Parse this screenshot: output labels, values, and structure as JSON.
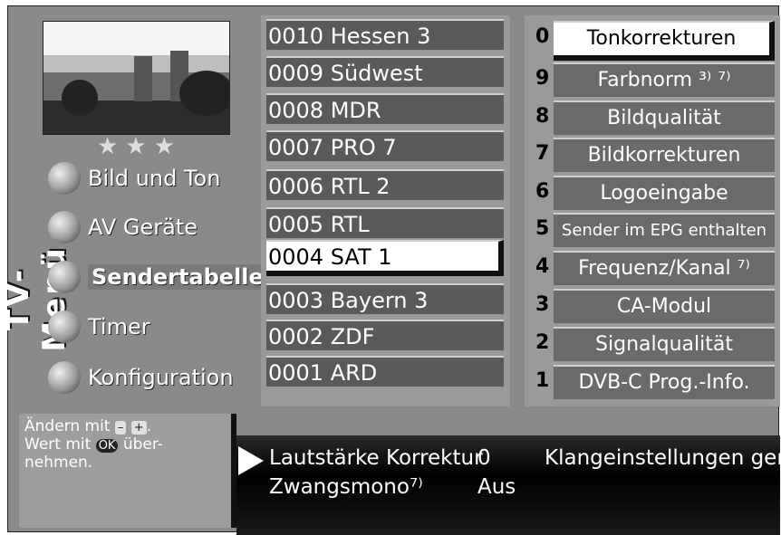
{
  "app": {
    "vertical_title": "TV-Menü"
  },
  "rating_stars": "★★★",
  "main_menu": [
    {
      "label": "Bild und Ton"
    },
    {
      "label": "AV Geräte"
    },
    {
      "label": "Sendertabelle",
      "selected": true
    },
    {
      "label": "Timer"
    },
    {
      "label": "Konfiguration"
    }
  ],
  "channels": [
    {
      "label": "0010 Hessen 3"
    },
    {
      "label": "0009 Südwest"
    },
    {
      "label": "0008 MDR"
    },
    {
      "label": "0007 PRO 7"
    },
    {
      "label": "0006 RTL 2"
    },
    {
      "label": "0005 RTL"
    },
    {
      "label": "0004 SAT 1",
      "selected": true
    },
    {
      "label": "0003 Bayern 3"
    },
    {
      "label": "0002 ZDF"
    },
    {
      "label": "0001 ARD"
    }
  ],
  "options": [
    {
      "num": "0",
      "label": "Tonkorrekturen",
      "selected": true
    },
    {
      "num": "9",
      "label": "Farbnorm ³⁾ ⁷⁾"
    },
    {
      "num": "8",
      "label": "Bildqualität"
    },
    {
      "num": "7",
      "label": "Bildkorrekturen"
    },
    {
      "num": "6",
      "label": "Logoeingabe"
    },
    {
      "num": "5",
      "label": "Sender im EPG enthalten"
    },
    {
      "num": "4",
      "label": "Frequenz/Kanal ⁷⁾"
    },
    {
      "num": "3",
      "label": "CA-Modul"
    },
    {
      "num": "2",
      "label": "Signalqualität"
    },
    {
      "num": "1",
      "label": "DVB-C Prog.-Info."
    }
  ],
  "hint": {
    "line1_prefix": "Ändern mit",
    "key_minus": "–",
    "key_plus": "+",
    "line1_suffix": ".",
    "line2_prefix": "Wert mit",
    "key_ok": "OK",
    "line2_suffix": "über-",
    "line3": "nehmen."
  },
  "info": {
    "row1_label": "Lautstärke Korrektur",
    "row1_value": "0",
    "row1_right": "Klangeinstellungen gen.",
    "row2_label": "Zwangsmono⁷⁾",
    "row2_value": "Aus"
  },
  "colors": {
    "panel": "#8a8a8a",
    "selected_bg": "#ffffff",
    "bar_bg": "#000000"
  }
}
